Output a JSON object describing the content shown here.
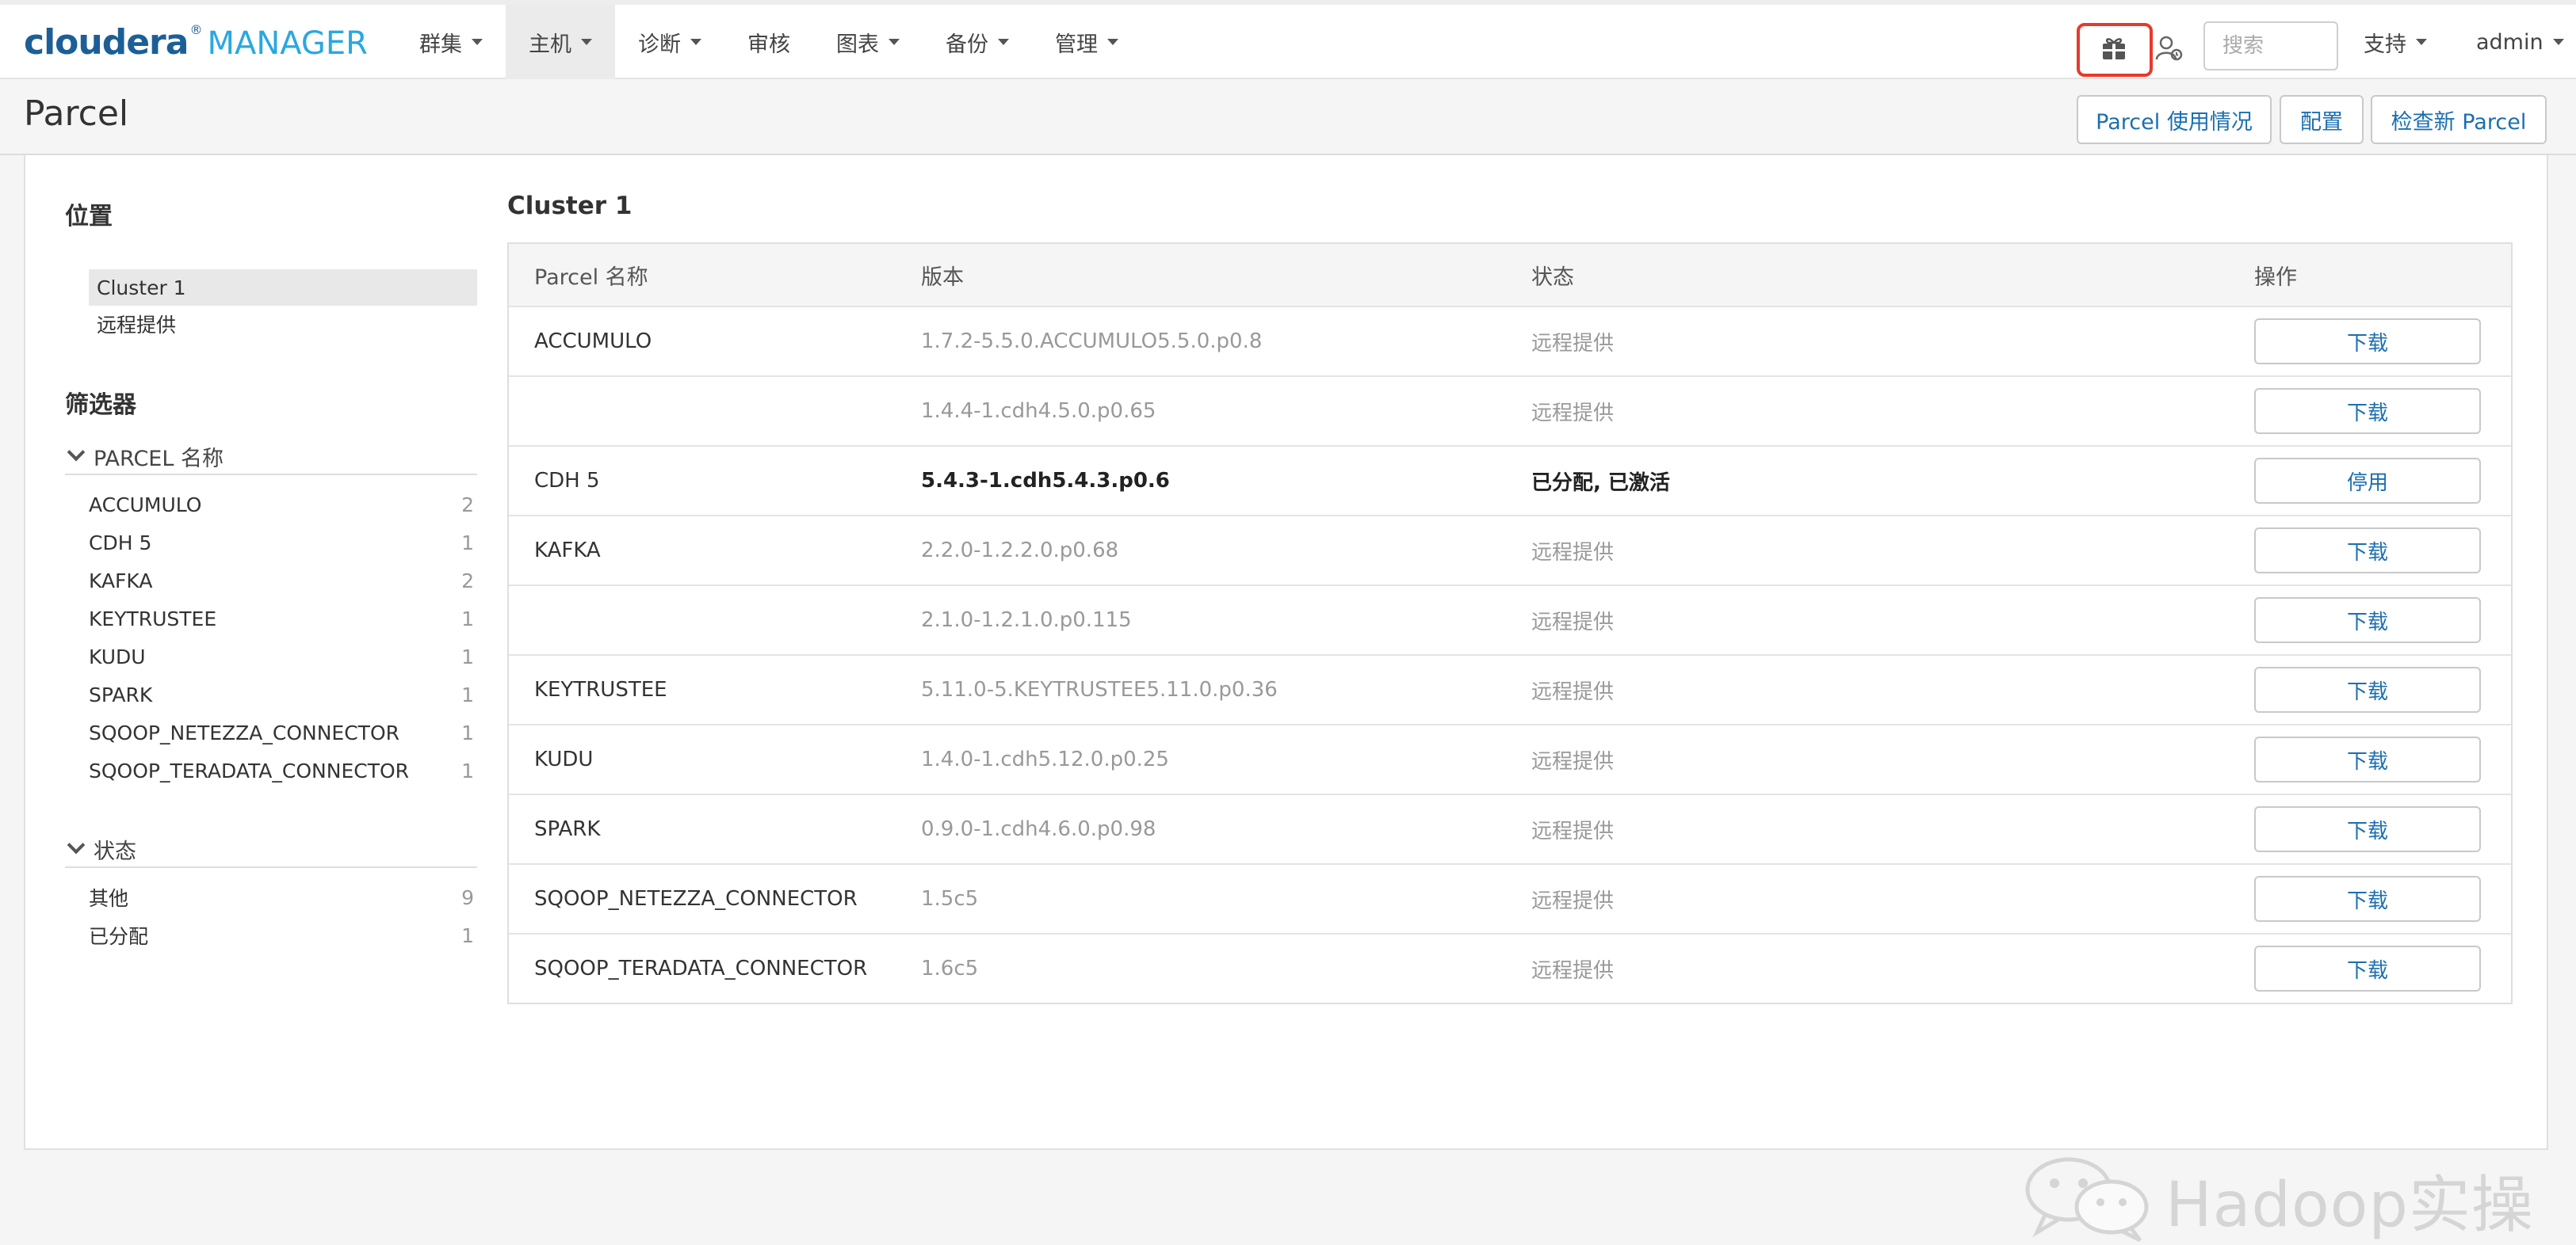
{
  "app": {
    "brand": "cloudera",
    "product": "MANAGER",
    "reg": "®"
  },
  "nav": {
    "items": [
      {
        "label": "群集",
        "dropdown": true,
        "active": false
      },
      {
        "label": "主机",
        "dropdown": true,
        "active": true
      },
      {
        "label": "诊断",
        "dropdown": true,
        "active": false
      },
      {
        "label": "审核",
        "dropdown": false,
        "active": false
      },
      {
        "label": "图表",
        "dropdown": true,
        "active": false
      },
      {
        "label": "备份",
        "dropdown": true,
        "active": false
      },
      {
        "label": "管理",
        "dropdown": true,
        "active": false
      }
    ],
    "search_placeholder": "搜索",
    "support_label": "支持",
    "user_label": "admin",
    "parcel_icon": "parcel-gift-icon",
    "user_status_icon": "user-status-icon",
    "highlight_color": "#e8392e"
  },
  "page": {
    "title": "Parcel",
    "buttons": {
      "usage": "Parcel 使用情况",
      "config": "配置",
      "check": "检查新 Parcel"
    }
  },
  "sidebar": {
    "location_heading": "位置",
    "locations": [
      {
        "label": "Cluster 1",
        "selected": true
      },
      {
        "label": "远程提供",
        "selected": false
      }
    ],
    "filter_heading": "筛选器",
    "parcel_filter": {
      "heading": "PARCEL 名称",
      "items": [
        {
          "label": "ACCUMULO",
          "count": "2"
        },
        {
          "label": "CDH 5",
          "count": "1"
        },
        {
          "label": "KAFKA",
          "count": "2"
        },
        {
          "label": "KEYTRUSTEE",
          "count": "1"
        },
        {
          "label": "KUDU",
          "count": "1"
        },
        {
          "label": "SPARK",
          "count": "1"
        },
        {
          "label": "SQOOP_NETEZZA_CONNECTOR",
          "count": "1"
        },
        {
          "label": "SQOOP_TERADATA_CONNECTOR",
          "count": "1"
        }
      ]
    },
    "status_filter": {
      "heading": "状态",
      "items": [
        {
          "label": "其他",
          "count": "9"
        },
        {
          "label": "已分配",
          "count": "1"
        }
      ]
    }
  },
  "main": {
    "cluster_title": "Cluster 1",
    "columns": {
      "name": "Parcel 名称",
      "version": "版本",
      "status": "状态",
      "action": "操作"
    },
    "rows": [
      {
        "name": "ACCUMULO",
        "version": "1.7.2-5.5.0.ACCUMULO5.5.0.p0.8",
        "status": "远程提供",
        "action": "下载"
      },
      {
        "name": "",
        "version": "1.4.4-1.cdh4.5.0.p0.65",
        "status": "远程提供",
        "action": "下载"
      },
      {
        "name": "CDH 5",
        "version": "5.4.3-1.cdh5.4.3.p0.6",
        "status": "已分配, 已激活",
        "action": "停用",
        "emphasis": true
      },
      {
        "name": "KAFKA",
        "version": "2.2.0-1.2.2.0.p0.68",
        "status": "远程提供",
        "action": "下载"
      },
      {
        "name": "",
        "version": "2.1.0-1.2.1.0.p0.115",
        "status": "远程提供",
        "action": "下载"
      },
      {
        "name": "KEYTRUSTEE",
        "version": "5.11.0-5.KEYTRUSTEE5.11.0.p0.36",
        "status": "远程提供",
        "action": "下载"
      },
      {
        "name": "KUDU",
        "version": "1.4.0-1.cdh5.12.0.p0.25",
        "status": "远程提供",
        "action": "下载"
      },
      {
        "name": "SPARK",
        "version": "0.9.0-1.cdh4.6.0.p0.98",
        "status": "远程提供",
        "action": "下载"
      },
      {
        "name": "SQOOP_NETEZZA_CONNECTOR",
        "version": "1.5c5",
        "status": "远程提供",
        "action": "下载"
      },
      {
        "name": "SQOOP_TERADATA_CONNECTOR",
        "version": "1.6c5",
        "status": "远程提供",
        "action": "下载"
      }
    ]
  },
  "watermark": {
    "text": "Hadoop实操",
    "icon": "wechat-icon"
  }
}
